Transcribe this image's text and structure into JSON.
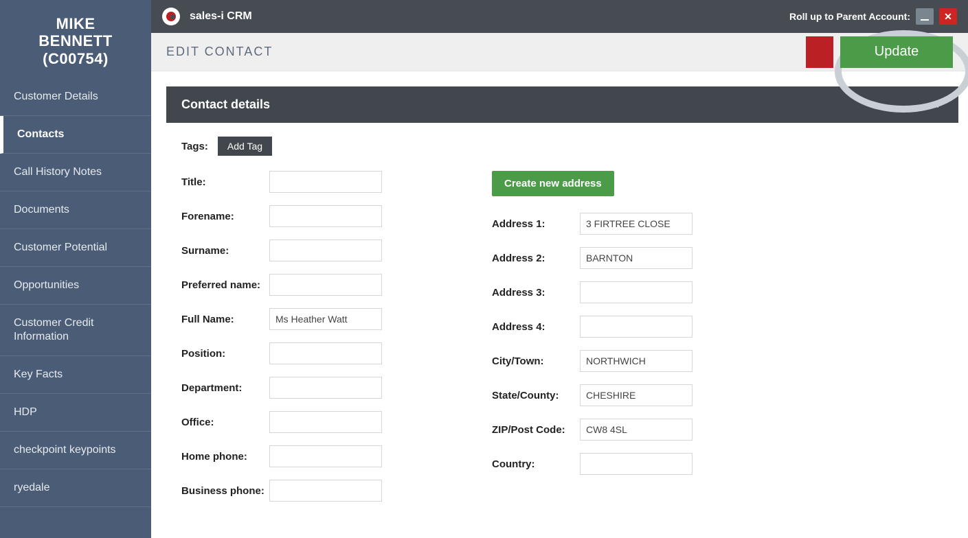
{
  "sidebar": {
    "title_line1": "MIKE",
    "title_line2": "BENNETT",
    "title_line3": "(C00754)",
    "items": [
      "Customer Details",
      "Contacts",
      "Call History Notes",
      "Documents",
      "Customer Potential",
      "Opportunities",
      "Customer Credit Information",
      "Key Facts",
      "HDP",
      "checkpoint keypoints",
      "ryedale"
    ],
    "active_index": 1
  },
  "topbar": {
    "app_title": "sales-i CRM",
    "roll_label": "Roll up to Parent Account:"
  },
  "editbar": {
    "title": "EDIT CONTACT",
    "update_label": "Update"
  },
  "section": {
    "title": "Contact details"
  },
  "tags": {
    "label": "Tags:",
    "add_label": "Add Tag"
  },
  "address_btn": "Create new address",
  "left_fields": [
    {
      "label": "Title:",
      "value": "",
      "readonly": false
    },
    {
      "label": "Forename:",
      "value": "",
      "readonly": false
    },
    {
      "label": "Surname:",
      "value": "",
      "readonly": false
    },
    {
      "label": "Preferred name:",
      "value": "",
      "readonly": false
    },
    {
      "label": "Full Name:",
      "value": "Ms Heather Watt",
      "readonly": true
    },
    {
      "label": "Position:",
      "value": "",
      "readonly": false
    },
    {
      "label": "Department:",
      "value": "",
      "readonly": false
    },
    {
      "label": "Office:",
      "value": "",
      "readonly": false
    },
    {
      "label": "Home phone:",
      "value": "",
      "readonly": false
    },
    {
      "label": "Business phone:",
      "value": "",
      "readonly": false
    }
  ],
  "right_fields": [
    {
      "label": "Address 1:",
      "value": "3 FIRTREE CLOSE",
      "readonly": true
    },
    {
      "label": "Address 2:",
      "value": "BARNTON",
      "readonly": true
    },
    {
      "label": "Address 3:",
      "value": "",
      "readonly": true
    },
    {
      "label": "Address 4:",
      "value": "",
      "readonly": true
    },
    {
      "label": "City/Town:",
      "value": "NORTHWICH",
      "readonly": true
    },
    {
      "label": "State/County:",
      "value": "CHESHIRE",
      "readonly": true
    },
    {
      "label": "ZIP/Post Code:",
      "value": "CW8 4SL",
      "readonly": true
    },
    {
      "label": "Country:",
      "value": "",
      "readonly": true
    }
  ]
}
